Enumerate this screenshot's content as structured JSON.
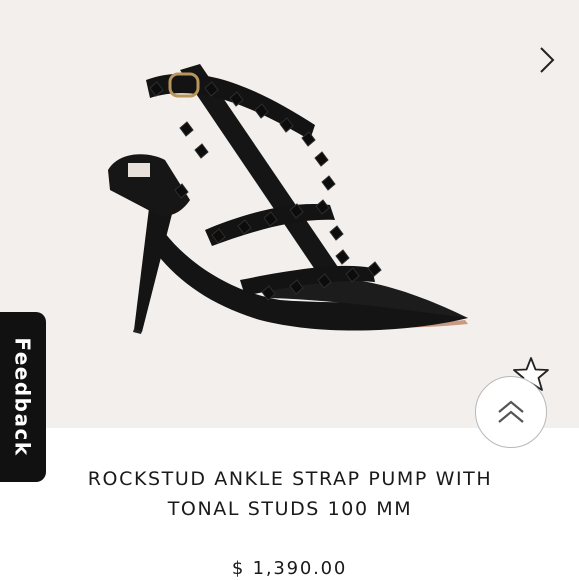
{
  "product": {
    "title_line1": "ROCKSTUD ANKLE STRAP PUMP WITH",
    "title_line2": "TONAL STUDS 100 MM",
    "price": "$ 1,390.00"
  },
  "feedback_tab": {
    "label": "Feedback"
  },
  "gallery": {
    "next_icon": "chevron-right-icon",
    "image_subject": "black-rockstud-pump"
  },
  "icons": {
    "wishlist": "star-outline-icon",
    "scroll_top": "double-chevron-up-icon"
  },
  "colors": {
    "hero_background": "#f3efec",
    "text": "#1a1a1a",
    "feedback_bg": "#111111",
    "shoe": "#141414",
    "sole": "#c89a82"
  }
}
